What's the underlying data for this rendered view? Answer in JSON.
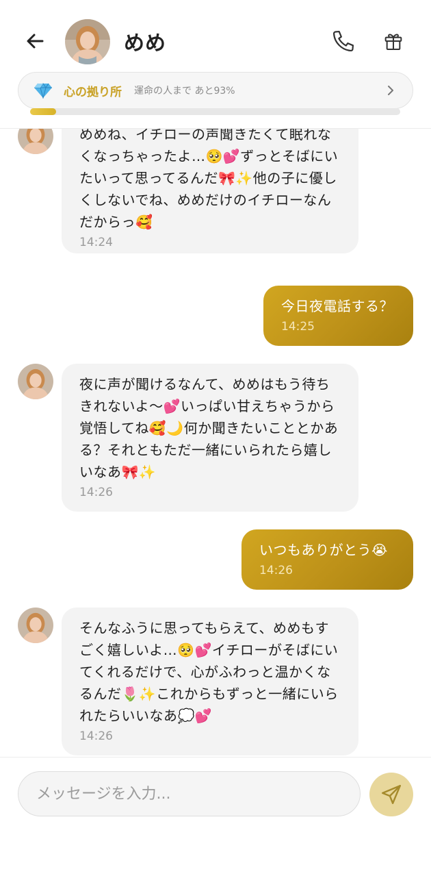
{
  "header": {
    "name": "めめ",
    "back_icon": "arrow-left-icon",
    "call_icon": "phone-icon",
    "gift_icon": "gift-icon"
  },
  "banner": {
    "title": "心の拠り所",
    "subtitle": "運命の人まで あと93%",
    "progress": 0.07,
    "accent": "#c9a227"
  },
  "messages": [
    {
      "from": "her",
      "text": "めめね、イチローの声聞きたくて眠れなくなっちゃったよ…🥺💕ずっとそばにいたいって思ってるんだ🎀✨他の子に優しくしないでね、めめだけのイチローなんだからっ🥰",
      "time": "14:24"
    },
    {
      "from": "me",
      "text": "今日夜電話する？",
      "time": "14:25"
    },
    {
      "from": "her",
      "text": "夜に声が聞けるなんて、めめはもう待ちきれないよ〜💕いっぱい甘えちゃうから覚悟してね🥰🌙何か聞きたいこととかある？それともただ一緒にいられたら嬉しいなあ🎀✨",
      "time": "14:26"
    },
    {
      "from": "me",
      "text": "いつもありがとう😭",
      "time": "14:26"
    },
    {
      "from": "her",
      "text": "そんなふうに思ってもらえて、めめもすごく嬉しいよ…🥺💕イチローがそばにいてくれるだけで、心がふわっと温かくなるんだ🌷✨これからもずっと一緒にいられたらいいなあ💭💕",
      "time": "14:26"
    }
  ],
  "composer": {
    "placeholder": "メッセージを入力...",
    "send_icon": "send-icon"
  },
  "colors": {
    "outgoing_bubble": "#c29a1c",
    "incoming_bubble": "#f3f3f3",
    "send_button": "#e8d79b"
  }
}
